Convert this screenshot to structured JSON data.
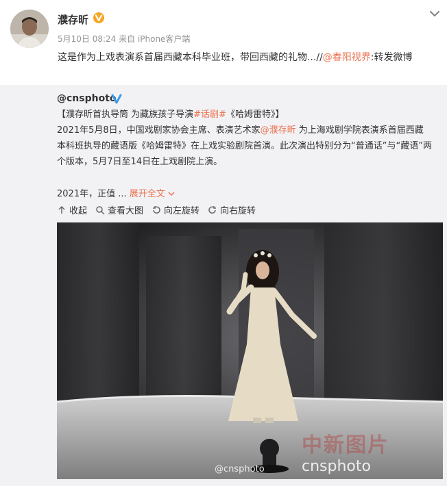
{
  "author": {
    "name": "濮存昕",
    "verified_icon": "v-badge-icon",
    "meta": "5月10日 08:24 来自 iPhone客户端",
    "post_prefix": "这是作为上戏表演系首届西藏本科毕业班，带回西藏的礼物...//",
    "post_mention": "@春阳视界",
    "post_suffix": ":转发微博"
  },
  "repost": {
    "name": "@cnsphoto",
    "verified_icon": "blue-v-badge-icon",
    "title_prefix": "【濮存昕首执导筒 为藏族孩子导演",
    "title_topic": "#话剧#",
    "title_suffix": "《哈姆雷特》】",
    "body_line1_a": "2021年5月8日，中国戏剧家协会主席、表演艺术家",
    "body_line1_mention": "@濮存昕",
    "body_line1_b": " 为上海戏剧学院表演系首届西藏",
    "body_line2": "本科班执导的藏语版《哈姆雷特》在上戏实验剧院首演。此次演出特别分为“普通话”与“藏语”两",
    "body_line3": "个版本，5月7日至14日在上戏剧院上演。",
    "summary": "2021年，正值 ... ",
    "expand_label": "展开全文",
    "tools": {
      "collapse": "收起",
      "view_large": "查看大图",
      "rotate_left": "向左旋转",
      "rotate_right": "向右旋转"
    },
    "photo_watermark": "@cnsphoto",
    "photo_watermark_logo": "中新图片",
    "photo_watermark_site": "cnsphoto"
  },
  "colors": {
    "accent": "#eb7350",
    "verified_gold": "#f5a623",
    "verified_blue": "#3d9ae8",
    "repost_bg": "#f2f2f5"
  }
}
